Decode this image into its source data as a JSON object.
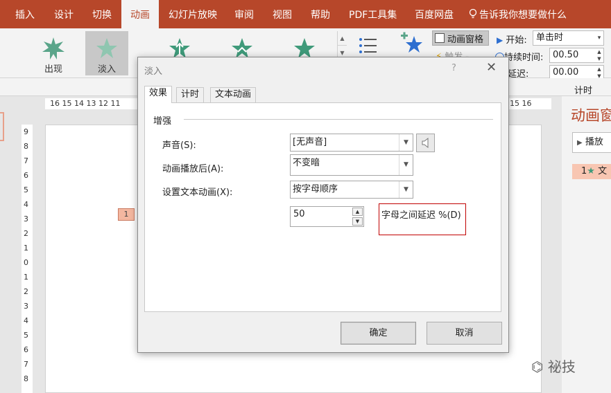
{
  "ribbon_tabs": [
    {
      "label": "插入",
      "active": false
    },
    {
      "label": "设计",
      "active": false
    },
    {
      "label": "切换",
      "active": false
    },
    {
      "label": "动画",
      "active": true
    },
    {
      "label": "幻灯片放映",
      "active": false
    },
    {
      "label": "审阅",
      "active": false
    },
    {
      "label": "视图",
      "active": false
    },
    {
      "label": "帮助",
      "active": false
    },
    {
      "label": "PDF工具集",
      "active": false
    },
    {
      "label": "百度网盘",
      "active": false
    },
    {
      "label": "告诉我你想要做什么",
      "active": false
    }
  ],
  "animations": [
    {
      "label": "出现",
      "selected": false
    },
    {
      "label": "淡入",
      "selected": true
    }
  ],
  "ribbon": {
    "animation_pane": "动画窗格",
    "trigger": "触发",
    "start_label": "开始:",
    "start_value": "单击时",
    "duration_label": "持续时间:",
    "duration_value": "00.50",
    "delay_label": "延迟:",
    "delay_value": "00.00",
    "timing_group": "计时"
  },
  "ruler": {
    "horizontal_left": "16 15 14 13 12 11",
    "horizontal_right": "15 16",
    "vertical": [
      "9",
      "8",
      "7",
      "6",
      "5",
      "4",
      "3",
      "2",
      "1",
      "0",
      "1",
      "2",
      "3",
      "4",
      "5",
      "6",
      "7",
      "8"
    ]
  },
  "slide_marker": "1",
  "pane": {
    "title": "动画窗",
    "play": "播放",
    "item_number": "1",
    "item_text": "文"
  },
  "dialog": {
    "title": "淡入",
    "help": "?",
    "close": "✕",
    "tabs": [
      {
        "label": "效果",
        "active": true
      },
      {
        "label": "计时",
        "active": false
      },
      {
        "label": "文本动画",
        "active": false
      }
    ],
    "group": "增强",
    "sound_label": "声音(S):",
    "sound_value": "[无声音]",
    "after_label": "动画播放后(A):",
    "after_value": "不变暗",
    "text_anim_label": "设置文本动画(X):",
    "text_anim_value": "按字母顺序",
    "delay_value": "50",
    "delay_label": "字母之间延迟 %(D)",
    "ok": "确定",
    "cancel": "取消"
  },
  "watermark": "祕技",
  "colors": {
    "accent": "#b7472a",
    "highlight_border": "#c00000",
    "star_green": "#5aa58a",
    "star_blue": "#2e6fd0"
  }
}
